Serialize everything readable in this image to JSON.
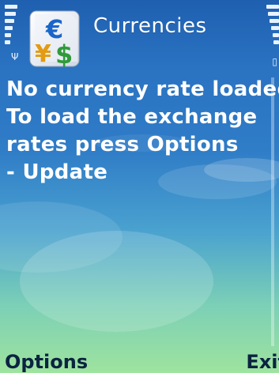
{
  "header": {
    "title": "Currencies",
    "app_icon": "currency-exchange-icon",
    "signal_icon": "signal-strength-icon",
    "battery_icon": "battery-level-icon"
  },
  "message": {
    "lines": [
      "No currency rate loaded.",
      "To load the exchange",
      "rates press Options",
      "- Update"
    ]
  },
  "softkeys": {
    "left_label": "Options",
    "right_label": "Exit"
  },
  "colors": {
    "background_top": "#1f5fb0",
    "background_bottom": "#9ee39e",
    "text": "#ffffff",
    "softkey_text": "#0b2340"
  }
}
